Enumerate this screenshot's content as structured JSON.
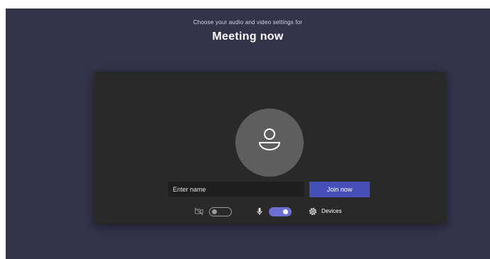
{
  "header": {
    "subtitle": "Choose your audio and video settings for",
    "title": "Meeting now"
  },
  "name_input": {
    "value": "",
    "placeholder": "Enter name"
  },
  "join_button": {
    "label": "Join now"
  },
  "controls": {
    "camera": {
      "icon": "camera-off-icon",
      "state": "off"
    },
    "microphone": {
      "icon": "microphone-icon",
      "state": "on"
    },
    "devices": {
      "icon": "gear-icon",
      "label": "Devices"
    }
  },
  "colors": {
    "background": "#33344a",
    "panel": "#2a2929",
    "accent": "#464eb8",
    "toggle_on": "#6b6fcf",
    "avatar": "#5e5e5e"
  }
}
